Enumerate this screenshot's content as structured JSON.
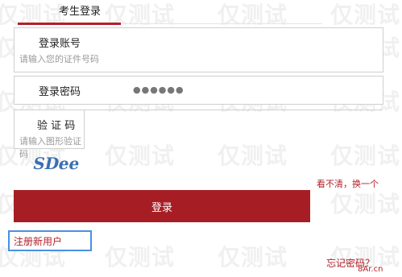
{
  "header": {
    "tab_label": "考生登录"
  },
  "account": {
    "label": "登录账号",
    "placeholder": "请输入您的证件号码"
  },
  "password": {
    "label": "登录密码",
    "masked": "●●●●●●"
  },
  "captcha": {
    "label": "验 证 码",
    "placeholder": "请输入图形验证码",
    "image_text": "SDee"
  },
  "refresh": {
    "label": "看不清，换一个"
  },
  "login": {
    "label": "登录"
  },
  "register": {
    "label": "注册新用户"
  },
  "forgot": {
    "label": "忘记密码？"
  },
  "watermark": {
    "text": "仅测试"
  },
  "brand": {
    "text": "8Ar.cn"
  },
  "colors": {
    "accent": "#a71d24",
    "link": "#b3202a",
    "border": "#cfcfcf",
    "focus": "#4a90e2"
  }
}
